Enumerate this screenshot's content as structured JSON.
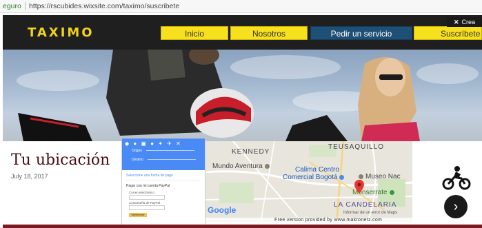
{
  "browser": {
    "secure_label": "eguro",
    "url": "https://rscubides.wixsite.com/taximo/suscribete"
  },
  "site": {
    "logo": "TAXIMO",
    "nav": [
      {
        "label": "Inicio"
      },
      {
        "label": "Nosotros"
      },
      {
        "label": "Pedir un servicio"
      },
      {
        "label": "Suscríbete"
      }
    ],
    "wix_banner": "Crea"
  },
  "content": {
    "title": "Tu ubicación",
    "date": "July 18, 2017"
  },
  "directions_panel": {
    "origin": "Origen",
    "destination": "Destino",
    "select_payment": "Seleccione una forma de pago",
    "paypal_option": "Pagar con mi cuenta PayPal",
    "email_label": "Correo electrónico",
    "password_label": "Contraseña de PayPal",
    "submit": "Identificarse"
  },
  "map": {
    "labels": {
      "kennedy": "KENNEDY",
      "teusaquillo": "TEUSAQUILLO",
      "mundo_aventura": "Mundo Aventura",
      "calima": "Calima Centro",
      "comercial": "Comercial Bogotá",
      "museo": "Museo Nac",
      "monserrate": "Monserrate",
      "candelaria": "LA CANDELARIA"
    },
    "google": "Google",
    "error_link": "Informar de un error de Maps",
    "free_version": "Free version provided by www.makronetz.com"
  },
  "colors": {
    "accent_yellow": "#f7e01d",
    "nav_blue": "#1e4f75",
    "title_maroon": "#4a0d12"
  }
}
